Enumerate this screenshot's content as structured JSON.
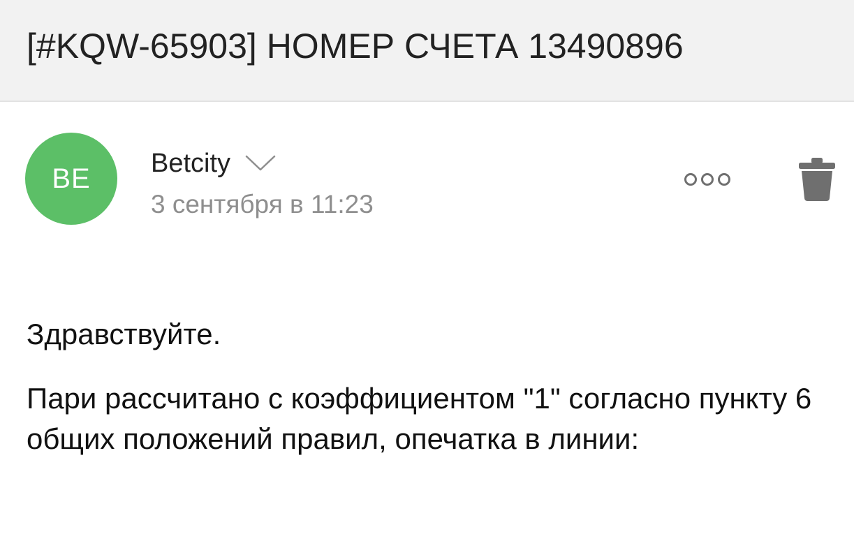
{
  "subject": "[#KQW-65903] НОМЕР СЧЕТА 13490896",
  "sender": {
    "initials": "BE",
    "name": "Betcity",
    "date": "3 сентября в 11:23",
    "avatar_color": "#5cbf67"
  },
  "toolbar": {
    "more_icon": "more-options-icon",
    "trash_icon": "trash-icon",
    "icon_color": "#6f6f6f"
  },
  "message": {
    "greeting": "Здравствуйте.",
    "paragraph": "Пари рассчитано с коэффициентом \"1\" согласно пункту 6 общих положений правил, опечатка в линии:"
  }
}
